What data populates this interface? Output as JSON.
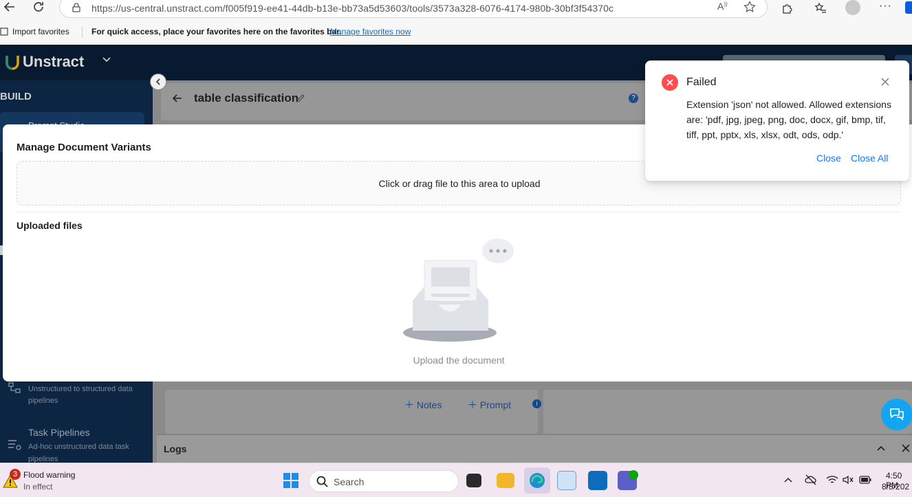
{
  "browser": {
    "url": "https://us-central.unstract.com/f005f919-ee41-44db-b13e-bb73a5d53603/tools/3573a328-6076-4174-980b-30bf3f54370c",
    "favorites_bar": {
      "import_label": "Import favorites",
      "hint": "For quick access, place your favorites here on the favorites bar.",
      "manage_link": "Manage favorites now"
    }
  },
  "app": {
    "brand": "Unstract",
    "sidebar": {
      "section_title": "BUILD",
      "items": [
        {
          "title": "Prompt Studio",
          "subtitle": ""
        },
        {
          "title": "",
          "subtitle": "Unstructured to structured data pipelines"
        },
        {
          "title": "Task Pipelines",
          "subtitle": "Ad-hoc unstructured data task pipelines"
        }
      ]
    },
    "project": {
      "title": "table classification"
    },
    "actions": {
      "notes_label": "Notes",
      "prompt_label": "Prompt"
    },
    "logs": {
      "label": "Logs"
    }
  },
  "modal": {
    "title": "Manage Document Variants",
    "upload_text": "Click or drag file to this area to upload",
    "uploaded_files_label": "Uploaded files",
    "empty_text": "Upload the document"
  },
  "notification": {
    "title": "Failed",
    "message": "Extension 'json' not allowed. Allowed extensions are: 'pdf, jpg, jpeg, png, doc, docx, gif, bmp, tif, tiff, ppt, pptx, xls, xlsx, odt, ods, odp.'",
    "close_label": "Close",
    "close_all_label": "Close All"
  },
  "taskbar": {
    "weather": {
      "badge": "3",
      "title": "Flood warning",
      "subtitle": "In effect"
    },
    "search_placeholder": "Search",
    "clock": {
      "time": "4:50 PM",
      "date": "8/8/202"
    }
  },
  "colors": {
    "accent": "#1677ff",
    "error": "#ff4d4f",
    "nav_dark": "#071a2f",
    "sidebar_dark": "#0b2542",
    "taskbar": "#f2e6f1"
  }
}
